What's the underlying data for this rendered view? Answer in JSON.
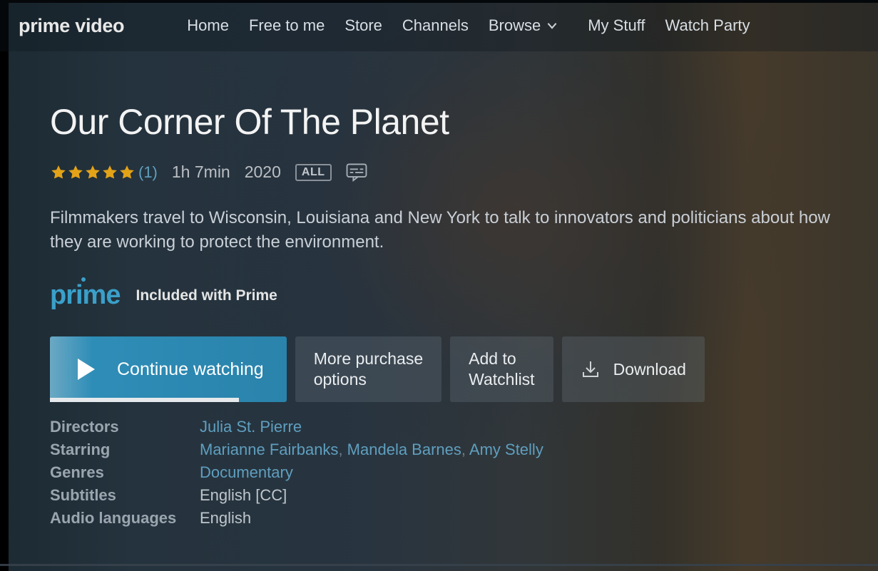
{
  "logo": "prime video",
  "nav": {
    "home": "Home",
    "free": "Free to me",
    "store": "Store",
    "channels": "Channels",
    "browse": "Browse",
    "my_stuff": "My Stuff",
    "watch_party": "Watch Party"
  },
  "title": "Our Corner Of The Planet",
  "rating_stars": 5,
  "rating_count": "(1)",
  "runtime": "1h 7min",
  "year": "2020",
  "content_rating": "ALL",
  "synopsis": "Filmmakers travel to Wisconsin, Louisiana and New York to talk to innovators and politicians about how they are working to protect the environment.",
  "prime_wordmark": "prime",
  "prime_text": "Included with Prime",
  "actions": {
    "play": "Continue watching",
    "play_progress_pct": 80,
    "more_line1": "More purchase",
    "more_line2": "options",
    "watchlist_line1": "Add to",
    "watchlist_line2": "Watchlist",
    "download": "Download"
  },
  "details": {
    "labels": {
      "directors": "Directors",
      "starring": "Starring",
      "genres": "Genres",
      "subtitles": "Subtitles",
      "audio": "Audio languages"
    },
    "directors": [
      "Julia St. Pierre"
    ],
    "starring": [
      "Marianne Fairbanks",
      "Mandela Barnes",
      "Amy Stelly"
    ],
    "genres": [
      "Documentary"
    ],
    "subtitles": "English [CC]",
    "audio": "English"
  }
}
